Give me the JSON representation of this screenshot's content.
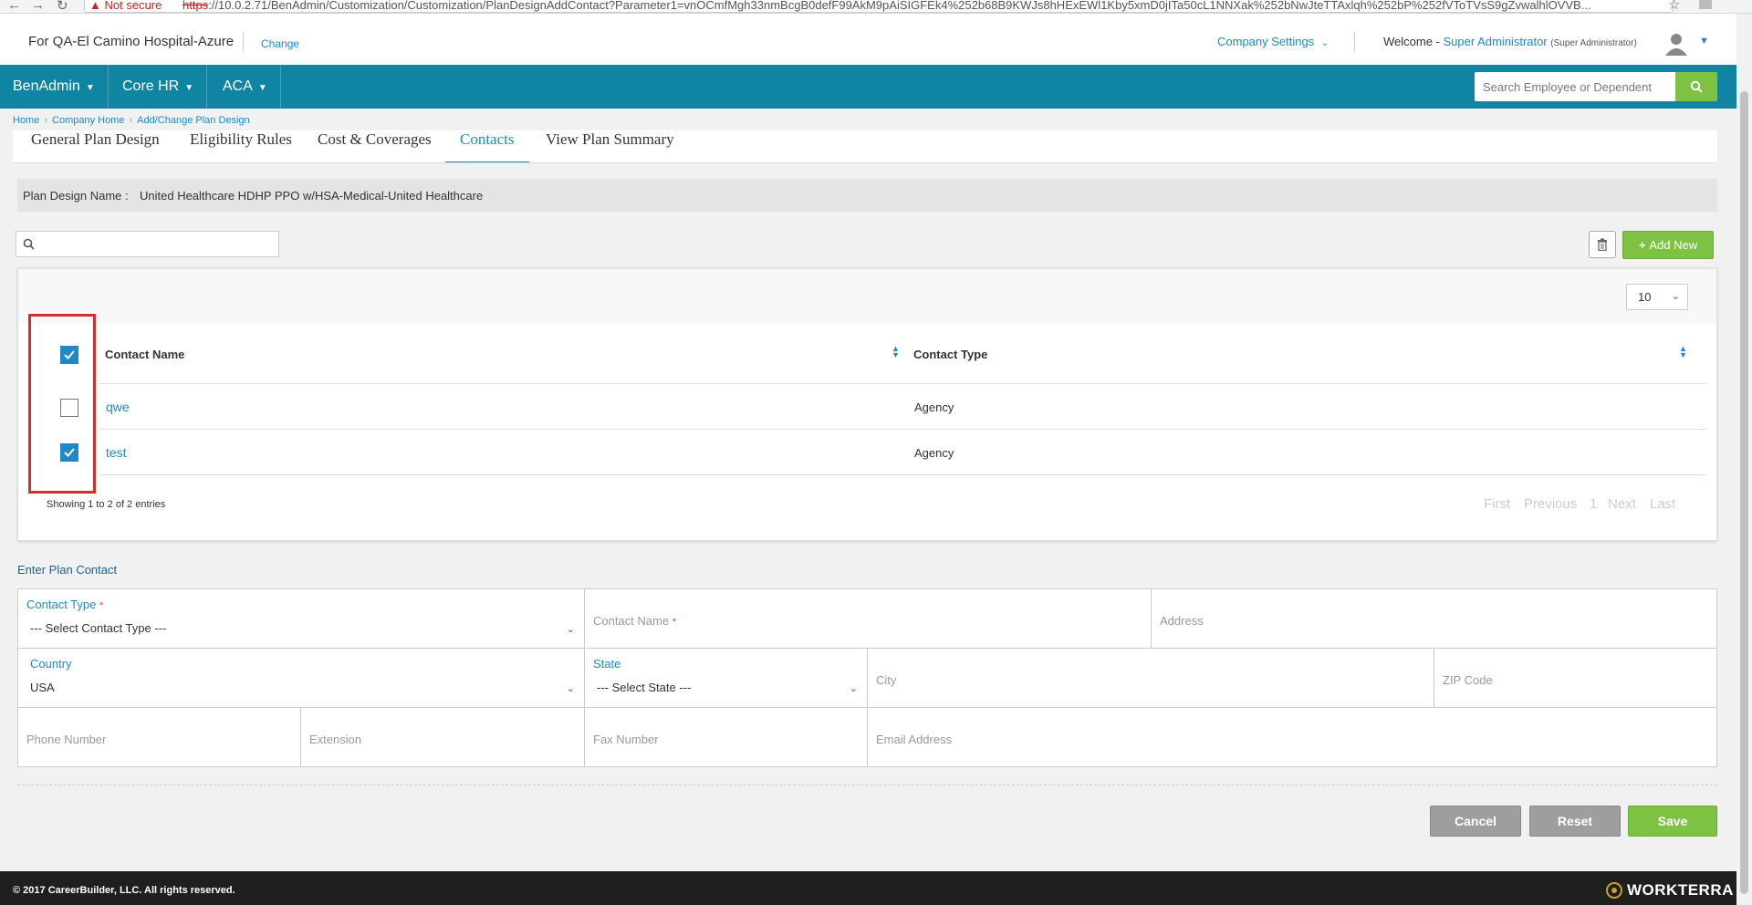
{
  "browser": {
    "security": "Not secure",
    "url_scheme": "https",
    "url_rest": "://10.0.2.71/BenAdmin/Customization/Customization/PlanDesignAddContact?Parameter1=vnOCmfMgh33nmBcgB0defF99AkM9pAiSIGFEk4%252b68B9KWJs8hHExEWl1Kby5xmD0jITa50cL1NNXak%252bNwJteTTAxlqh%252bP%252fVToTVsS9gZvwalhlOVVB..."
  },
  "header": {
    "client": "For QA-El Camino Hospital-Azure",
    "change": "Change",
    "company_settings": "Company Settings",
    "welcome": "Welcome - ",
    "user_name": "Super Administrator",
    "user_role": "(Super Administrator)"
  },
  "nav": {
    "items": [
      "BenAdmin",
      "Core HR",
      "ACA"
    ],
    "search_placeholder": "Search Employee or Dependent"
  },
  "breadcrumb": [
    "Home",
    "Company Home",
    "Add/Change Plan Design"
  ],
  "tabs": [
    "General Plan Design",
    "Eligibility Rules",
    "Cost & Coverages",
    "Contacts",
    "View Plan Summary"
  ],
  "plan": {
    "label": "Plan Design Name :",
    "value": "United Healthcare HDHP PPO w/HSA-Medical-United Healthcare"
  },
  "actions": {
    "add_new": "Add New"
  },
  "table": {
    "page_size": "10",
    "columns": [
      "Contact Name",
      "Contact Type"
    ],
    "rows": [
      {
        "name": "qwe",
        "type": "Agency",
        "checked": false
      },
      {
        "name": "test",
        "type": "Agency",
        "checked": true
      }
    ],
    "showing": "Showing 1 to 2 of 2 entries",
    "pager": [
      "First",
      "Previous",
      "1",
      "Next",
      "Last"
    ]
  },
  "form": {
    "title": "Enter Plan Contact",
    "contact_type_label": "Contact Type",
    "contact_type_value": "--- Select Contact Type ---",
    "contact_name_ph": "Contact Name",
    "address_ph": "Address",
    "country_label": "Country",
    "country_value": "USA",
    "state_label": "State",
    "state_value": "--- Select State ---",
    "city_ph": "City",
    "zip_ph": "ZIP Code",
    "phone_ph": "Phone Number",
    "extension_ph": "Extension",
    "fax_ph": "Fax Number",
    "email_ph": "Email Address",
    "required_mark": "*"
  },
  "buttons": {
    "cancel": "Cancel",
    "reset": "Reset",
    "save": "Save"
  },
  "footer": {
    "copyright": "© 2017 CareerBuilder, LLC. All rights reserved.",
    "brand": "WORKTERRA"
  },
  "colors": {
    "nav": "#0f84a3",
    "accent": "#1e88c8",
    "green": "#7dc242",
    "highlight": "#d32f2f"
  }
}
